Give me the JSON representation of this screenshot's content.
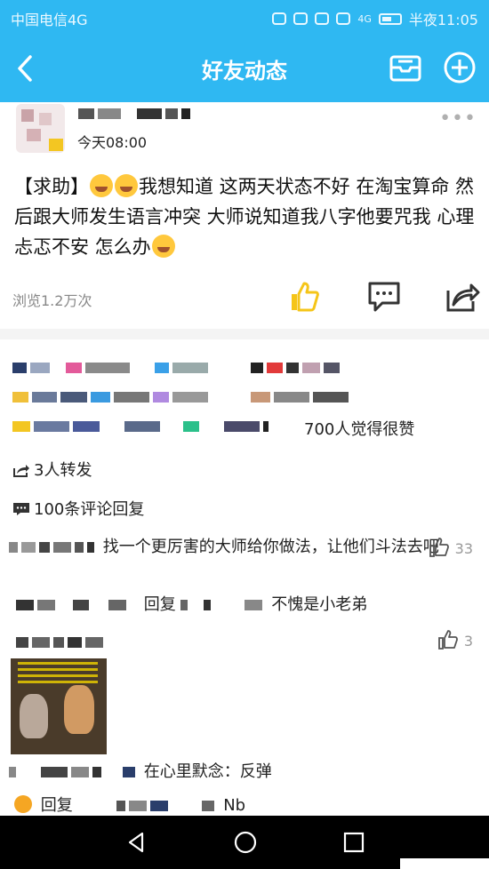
{
  "status_bar": {
    "carrier": "中国电信4G",
    "time_text": "半夜11:05",
    "signal_label": "4G"
  },
  "header": {
    "title": "好友动态",
    "icons": [
      "back-arrow-icon",
      "message-box-icon",
      "add-circle-icon"
    ],
    "color": "#2fb8f2"
  },
  "post": {
    "time": "今天08:00",
    "more": "•••",
    "parts": [
      "【求助】",
      "我想知道 这两天状态不好 在淘宝算命 然后跟大师发生语言冲突 大师说知道我八字他要咒我 心理忐忑不安 怎么办"
    ],
    "views": "浏览1.2万次",
    "actions": [
      "like-icon",
      "comment-icon",
      "share-icon"
    ]
  },
  "social": {
    "likes_text": "700人觉得很赞",
    "forwards": "3人转发",
    "comments_count": "100条评论回复"
  },
  "comments": [
    {
      "text": "找一个更厉害的大师给你做法，让他们斗法去吧",
      "likes": "33"
    },
    {
      "reply_prefix": "回复",
      "text": "不愧是小老弟"
    },
    {
      "likes": "3"
    },
    {
      "text": "在心里默念：反弹"
    },
    {
      "reply_prefix": "回复",
      "text": "Nb"
    }
  ],
  "navbar": {
    "icons": [
      "nav-back-icon",
      "nav-home-icon",
      "nav-recent-icon"
    ]
  }
}
